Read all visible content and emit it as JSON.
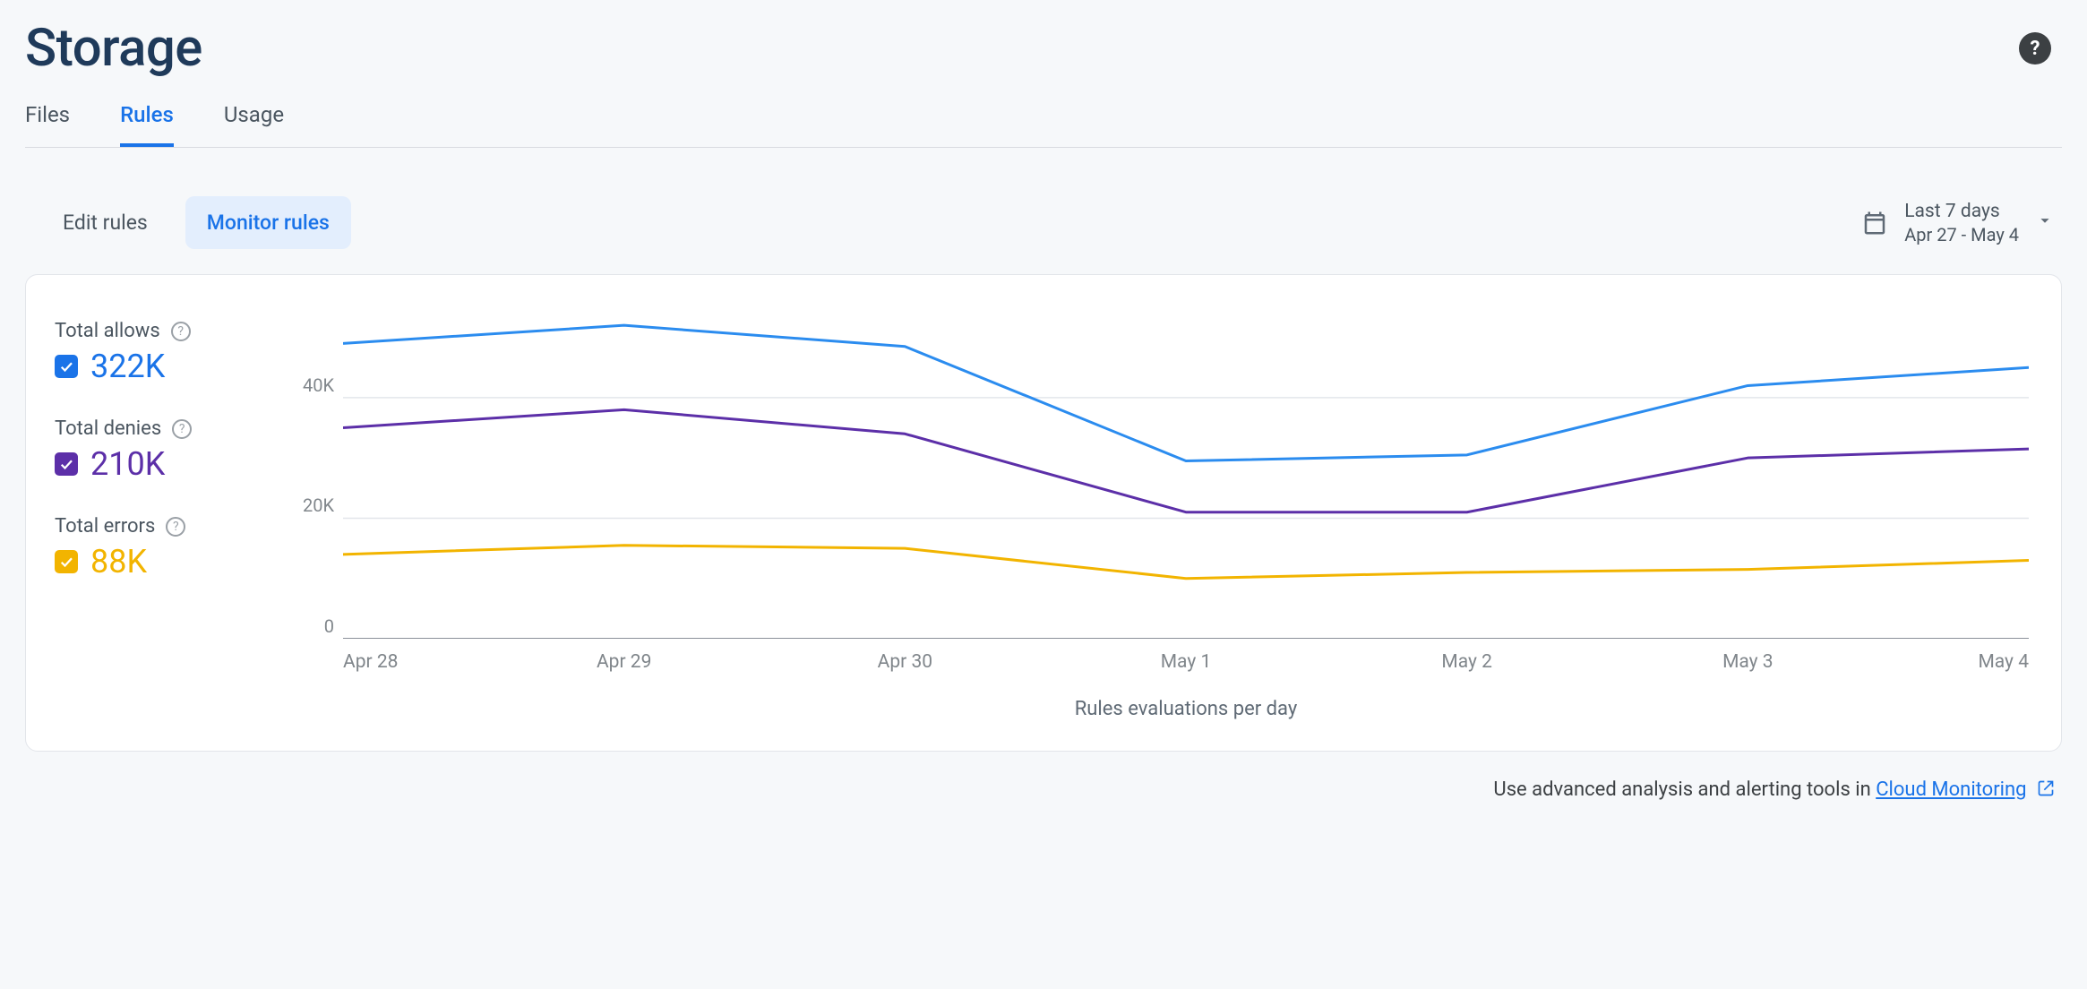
{
  "page_title": "Storage",
  "tabs": [
    "Files",
    "Rules",
    "Usage"
  ],
  "active_tab_index": 1,
  "subtabs": [
    "Edit rules",
    "Monitor rules"
  ],
  "active_subtab_index": 1,
  "date_picker": {
    "label": "Last 7 days",
    "range": "Apr 27 - May 4"
  },
  "legend": [
    {
      "label": "Total allows",
      "value": "322K",
      "color": "#1a73e8",
      "checked": true
    },
    {
      "label": "Total denies",
      "value": "210K",
      "color": "#5c2fa8",
      "checked": true
    },
    {
      "label": "Total errors",
      "value": "88K",
      "color": "#f2b400",
      "checked": true
    }
  ],
  "chart_caption": "Rules evaluations per day",
  "footer_text": "Use advanced analysis and alerting tools in ",
  "footer_link_text": "Cloud Monitoring",
  "chart_data": {
    "type": "line",
    "xlabel": "",
    "ylabel": "",
    "categories": [
      "Apr 28",
      "Apr 29",
      "Apr 30",
      "May 1",
      "May 2",
      "May 3",
      "May 4"
    ],
    "y_ticks": [
      0,
      20000,
      40000
    ],
    "y_tick_labels": [
      "0",
      "20K",
      "40K"
    ],
    "ylim": [
      0,
      55000
    ],
    "series": [
      {
        "name": "Total allows",
        "color": "#2b8cef",
        "values": [
          49000,
          52000,
          48500,
          29500,
          30500,
          42000,
          45000
        ]
      },
      {
        "name": "Total denies",
        "color": "#5c2fa8",
        "values": [
          35000,
          38000,
          34000,
          21000,
          21000,
          30000,
          31500
        ]
      },
      {
        "name": "Total errors",
        "color": "#f2b400",
        "values": [
          14000,
          15500,
          15000,
          10000,
          11000,
          11500,
          13000
        ]
      }
    ]
  }
}
